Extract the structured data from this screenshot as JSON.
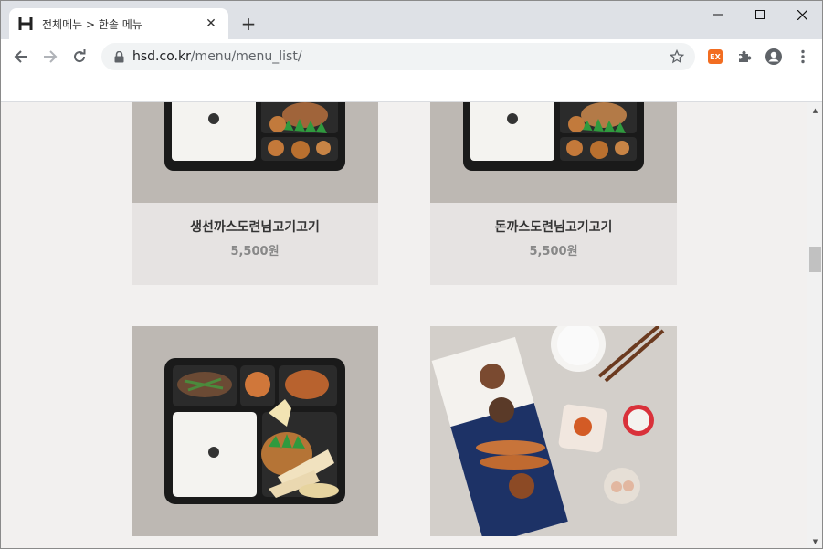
{
  "tab": {
    "title": "전체메뉴 > 한솥 메뉴",
    "close": "✕",
    "new_tab": "+"
  },
  "window": {
    "minimize": "—",
    "maximize": "☐",
    "close": "✕"
  },
  "omnibox": {
    "host": "hsd.co.kr",
    "path": "/menu/menu_list/"
  },
  "extensions": {
    "ex_badge": "EX"
  },
  "menu_items": [
    {
      "name": "생선까스도련님고기고기",
      "price": "5,500원"
    },
    {
      "name": "돈까스도련님고기고기",
      "price": "5,500원"
    }
  ],
  "colors": {
    "accent": "#f26d21",
    "card_bg": "#e6e3e2",
    "photo_bg": "#bdb8b3",
    "page_bg": "#f2f0ef"
  }
}
